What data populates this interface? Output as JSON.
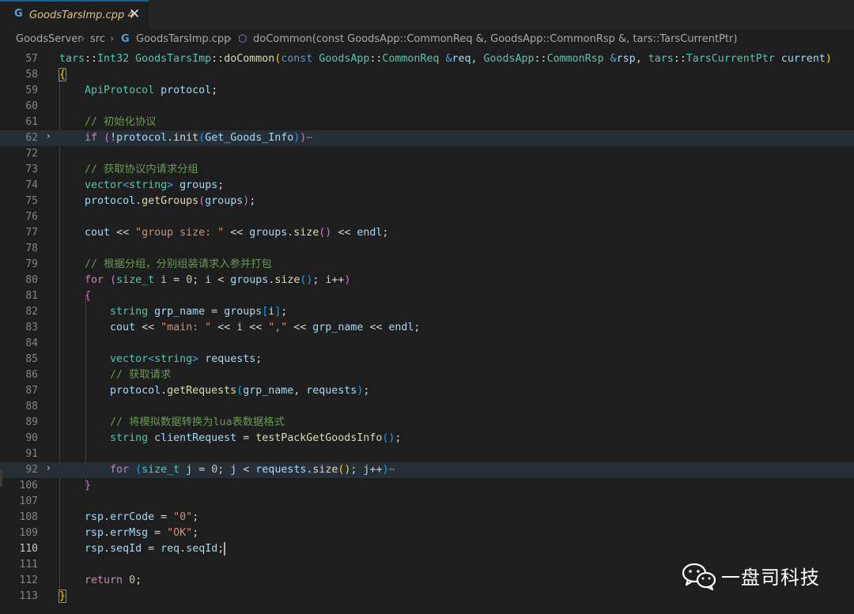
{
  "tab": {
    "icon": "G",
    "title": "GoodsTarsImp.cpp 4",
    "close": "✕"
  },
  "breadcrumb": {
    "folder1": "GoodsServer",
    "folder2": "src",
    "file_icon": "G",
    "file": "GoodsTarsImp.cpp",
    "method_icon": "⬡",
    "method": "doCommon(const GoodsApp::CommonReq &, GoodsApp::CommonRsp &, tars::TarsCurrentPtr)"
  },
  "line_numbers": [
    "57",
    "58",
    "59",
    "60",
    "61",
    "62",
    "72",
    "73",
    "74",
    "75",
    "76",
    "77",
    "78",
    "79",
    "80",
    "81",
    "82",
    "83",
    "84",
    "85",
    "86",
    "87",
    "88",
    "89",
    "90",
    "91",
    "92",
    "106",
    "107",
    "108",
    "109",
    "110",
    "111",
    "112",
    "113"
  ],
  "watermark": {
    "text": "一盘司科技",
    "icon": "wechat-icon"
  },
  "colors": {
    "background": "#1e1e1e",
    "keyword": "#569cd6",
    "type": "#4ec9b0",
    "function": "#dcdcaa",
    "string": "#ce9178",
    "comment": "#6a9955"
  }
}
